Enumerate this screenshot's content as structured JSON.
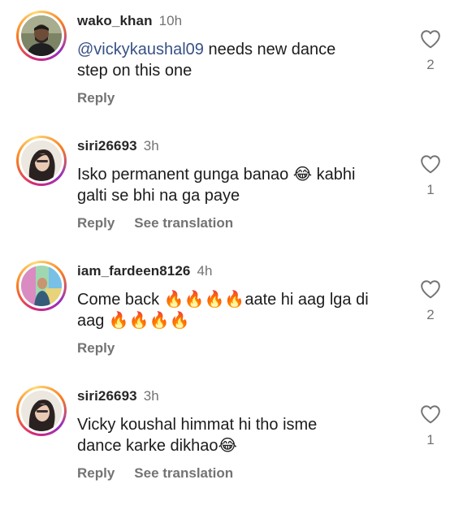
{
  "comments": [
    {
      "username": "wako_khan",
      "time": "10h",
      "mention": "@vickykaushal09",
      "text_line1": " needs new dance",
      "text_line2": "step on this one",
      "reply_label": "Reply",
      "translation_label": "",
      "likes": "2",
      "avatar_colors": [
        "#8a8f70",
        "#3a3a2e"
      ]
    },
    {
      "username": "siri26693",
      "time": "3h",
      "text_line1": "Isko permanent gunga banao 😂 kabhi",
      "text_line2": "galti se bhi na ga paye",
      "reply_label": "Reply",
      "translation_label": "See translation",
      "likes": "1",
      "avatar_colors": [
        "#e9e4dc",
        "#2b2320"
      ]
    },
    {
      "username": "iam_fardeen8126",
      "time": "4h",
      "text_line1": "Come back 🔥🔥🔥🔥aate hi aag lga di",
      "text_line2": "aag 🔥🔥🔥🔥",
      "reply_label": "Reply",
      "translation_label": "",
      "likes": "2",
      "avatar_colors": [
        "#a0d8a0",
        "#d48ac0"
      ]
    },
    {
      "username": "siri26693",
      "time": "3h",
      "text_line1": "Vicky koushal himmat hi tho isme",
      "text_line2": "dance karke dikhao😂",
      "reply_label": "Reply",
      "translation_label": "See translation",
      "likes": "1",
      "avatar_colors": [
        "#e9e4dc",
        "#2b2320"
      ]
    }
  ],
  "icons": {
    "like": "heart-outline-icon"
  }
}
